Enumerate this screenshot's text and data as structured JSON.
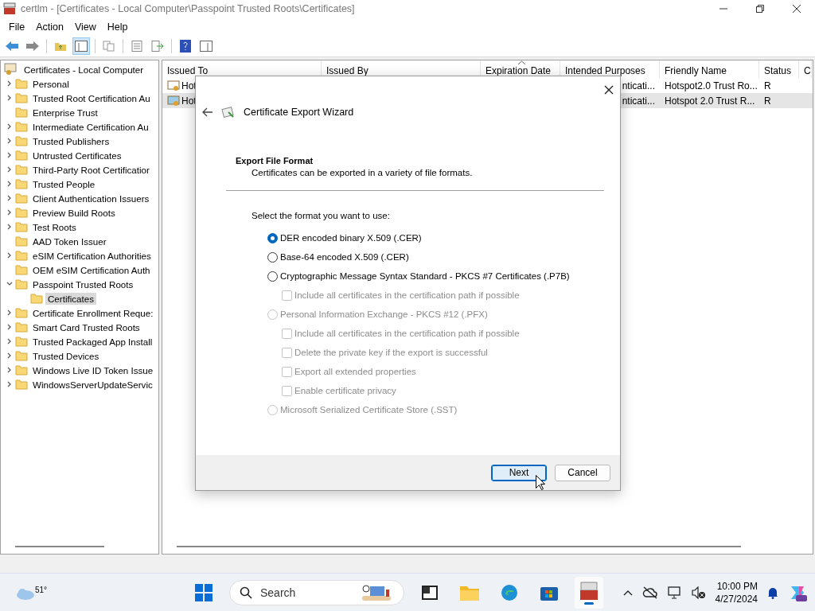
{
  "window": {
    "title": "certlm - [Certificates - Local Computer\\Passpoint Trusted Roots\\Certificates]"
  },
  "menu": [
    "File",
    "Action",
    "View",
    "Help"
  ],
  "tree": {
    "label": "Certificates - Local Computer",
    "children": [
      {
        "label": "Personal",
        "expandable": true,
        "expanded": false,
        "selected": false
      },
      {
        "label": "Trusted Root Certification Au",
        "expandable": true,
        "expanded": false,
        "selected": false
      },
      {
        "label": "Enterprise Trust",
        "expandable": false,
        "expanded": false,
        "selected": false
      },
      {
        "label": "Intermediate Certification Au",
        "expandable": true,
        "expanded": false,
        "selected": false
      },
      {
        "label": "Trusted Publishers",
        "expandable": true,
        "expanded": false,
        "selected": false
      },
      {
        "label": "Untrusted Certificates",
        "expandable": true,
        "expanded": false,
        "selected": false
      },
      {
        "label": "Third-Party Root Certificatior",
        "expandable": true,
        "expanded": false,
        "selected": false
      },
      {
        "label": "Trusted People",
        "expandable": true,
        "expanded": false,
        "selected": false
      },
      {
        "label": "Client Authentication Issuers",
        "expandable": true,
        "expanded": false,
        "selected": false
      },
      {
        "label": "Preview Build Roots",
        "expandable": true,
        "expanded": false,
        "selected": false
      },
      {
        "label": "Test Roots",
        "expandable": true,
        "expanded": false,
        "selected": false
      },
      {
        "label": "AAD Token Issuer",
        "expandable": false,
        "expanded": false,
        "selected": false
      },
      {
        "label": "eSIM Certification Authorities",
        "expandable": true,
        "expanded": false,
        "selected": false
      },
      {
        "label": "OEM eSIM Certification Auth",
        "expandable": false,
        "expanded": false,
        "selected": false
      },
      {
        "label": "Passpoint Trusted Roots",
        "expandable": true,
        "expanded": true,
        "selected": false,
        "children": [
          {
            "label": "Certificates",
            "expandable": false,
            "expanded": false,
            "selected": true
          }
        ]
      },
      {
        "label": "Certificate Enrollment Reque:",
        "expandable": true,
        "expanded": false,
        "selected": false
      },
      {
        "label": "Smart Card Trusted Roots",
        "expandable": true,
        "expanded": false,
        "selected": false
      },
      {
        "label": "Trusted Packaged App Install",
        "expandable": true,
        "expanded": false,
        "selected": false
      },
      {
        "label": "Trusted Devices",
        "expandable": true,
        "expanded": false,
        "selected": false
      },
      {
        "label": "Windows Live ID Token Issue",
        "expandable": true,
        "expanded": false,
        "selected": false
      },
      {
        "label": "WindowsServerUpdateServic",
        "expandable": true,
        "expanded": false,
        "selected": false
      }
    ]
  },
  "table": {
    "columns": [
      "Issued To",
      "Issued By",
      "Expiration Date",
      "Intended Purposes",
      "Friendly Name",
      "Status",
      "C"
    ],
    "rows": [
      {
        "issued_to": "Hot",
        "intended_purposes": "nticati...",
        "friendly_name": "Hotspot2.0 Trust Ro...",
        "status": "R",
        "selected": false
      },
      {
        "issued_to": "Hot",
        "intended_purposes": "nticati...",
        "friendly_name": "Hotspot 2.0 Trust R...",
        "status": "R",
        "selected": true
      }
    ]
  },
  "dialog": {
    "title": "Certificate Export Wizard",
    "heading": "Export File Format",
    "subheading": "Certificates can be exported in a variety of file formats.",
    "prompt": "Select the format you want to use:",
    "options": [
      {
        "kind": "radio",
        "label": "DER encoded binary X.509 (.CER)",
        "selected": true,
        "disabled": false
      },
      {
        "kind": "radio",
        "label": "Base-64 encoded X.509 (.CER)",
        "selected": false,
        "disabled": false
      },
      {
        "kind": "radio",
        "label": "Cryptographic Message Syntax Standard - PKCS #7 Certificates (.P7B)",
        "selected": false,
        "disabled": false,
        "children": [
          {
            "kind": "checkbox",
            "label": "Include all certificates in the certification path if possible",
            "checked": false,
            "disabled": true
          }
        ]
      },
      {
        "kind": "radio",
        "label": "Personal Information Exchange - PKCS #12 (.PFX)",
        "selected": false,
        "disabled": true,
        "children": [
          {
            "kind": "checkbox",
            "label": "Include all certificates in the certification path if possible",
            "checked": false,
            "disabled": true
          },
          {
            "kind": "checkbox",
            "label": "Delete the private key if the export is successful",
            "checked": false,
            "disabled": true
          },
          {
            "kind": "checkbox",
            "label": "Export all extended properties",
            "checked": false,
            "disabled": true
          },
          {
            "kind": "checkbox",
            "label": "Enable certificate privacy",
            "checked": false,
            "disabled": true
          }
        ]
      },
      {
        "kind": "radio",
        "label": "Microsoft Serialized Certificate Store (.SST)",
        "selected": false,
        "disabled": true
      }
    ],
    "buttons": [
      {
        "label": "Next",
        "default": true
      },
      {
        "label": "Cancel",
        "default": false
      }
    ]
  },
  "taskbar": {
    "weather": "51°",
    "search": {
      "placeholder": "Search"
    },
    "time": "10:00 PM",
    "date": "4/27/2024"
  }
}
